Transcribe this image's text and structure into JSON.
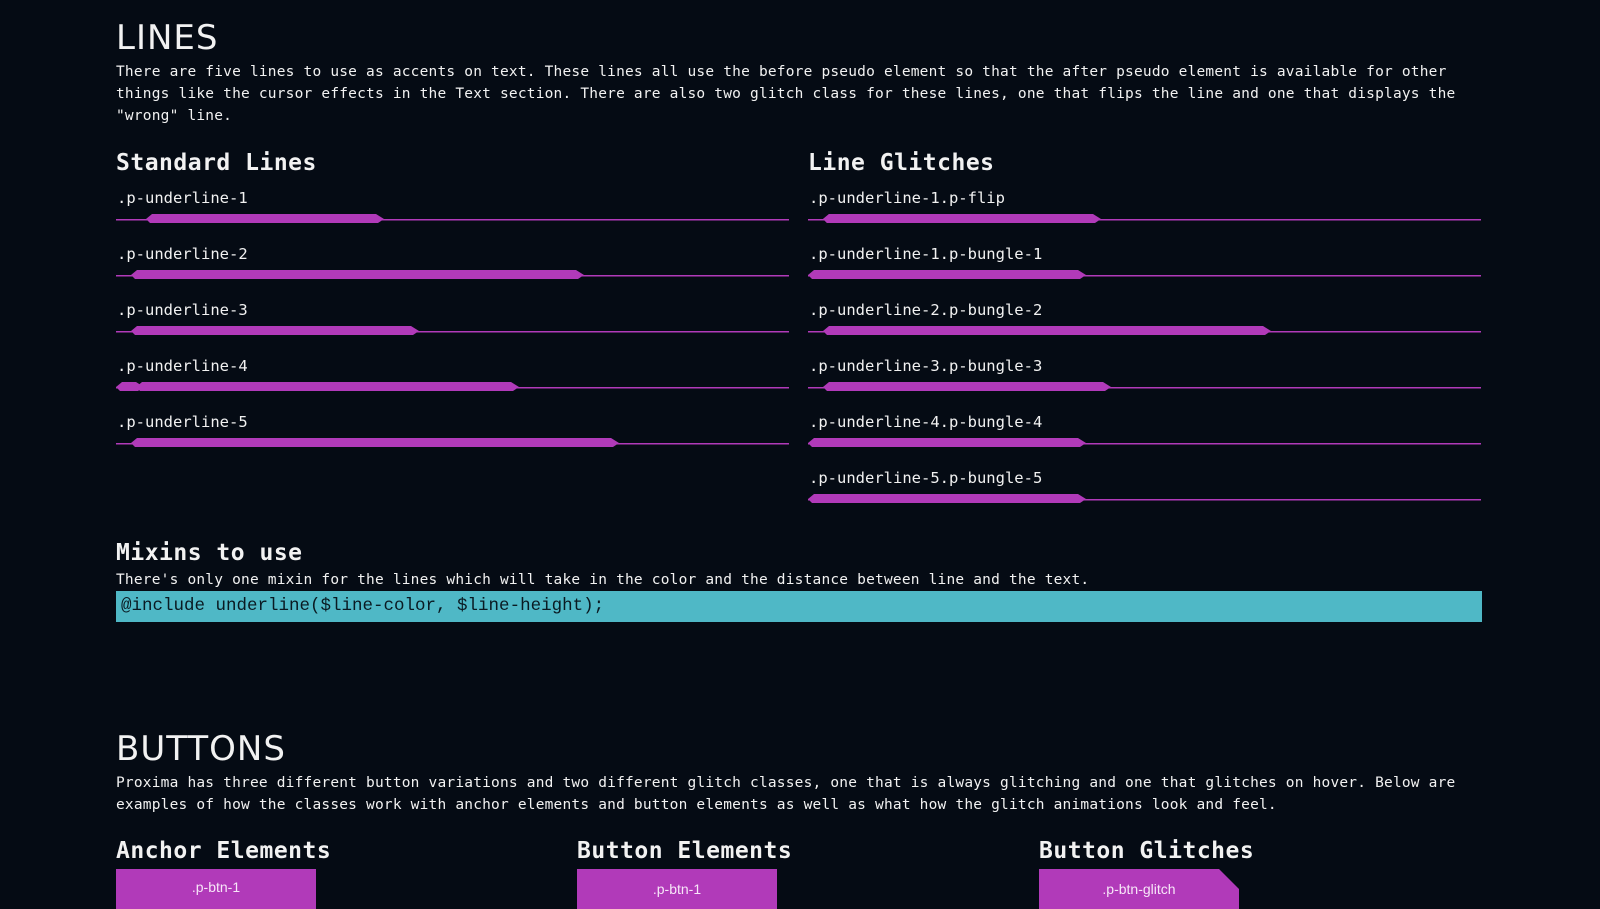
{
  "lines": {
    "title": "LINES",
    "description": "There are five lines to use as accents on text. These lines all use the before pseudo element so that the after pseudo element is available for other things like the cursor effects in the Text section. There are also two glitch class for these lines, one that flips the line and one that displays the \"wrong\" line.",
    "standard": {
      "title": "Standard Lines",
      "items": [
        ".p-underline-1",
        ".p-underline-2",
        ".p-underline-3",
        ".p-underline-4",
        ".p-underline-5"
      ]
    },
    "glitches": {
      "title": "Line Glitches",
      "items": [
        ".p-underline-1.p-flip",
        ".p-underline-1.p-bungle-1",
        ".p-underline-2.p-bungle-2",
        ".p-underline-3.p-bungle-3",
        ".p-underline-4.p-bungle-4",
        ".p-underline-5.p-bungle-5"
      ]
    }
  },
  "mixins": {
    "title": "Mixins to use",
    "description": "There's only one mixin for the lines which will take in the color and the distance between line and the text.",
    "code": "@include underline($line-color, $line-height);"
  },
  "buttons": {
    "title": "BUTTONS",
    "description": "Proxima has three different button variations and two different glitch classes, one that is always glitching and one that glitches on hover. Below are examples of how the classes work with anchor elements and button elements as well as what how the glitch animations look and feel.",
    "anchor_title": "Anchor Elements",
    "anchor_button": ".p-btn-1",
    "button_title": "Button Elements",
    "button_button": ".p-btn-1",
    "glitch_title": "Button Glitches",
    "glitch_button": ".p-btn-glitch"
  },
  "colors": {
    "background": "#050b14",
    "accent": "#b13ab9",
    "code_bg": "#4fb8c6"
  }
}
